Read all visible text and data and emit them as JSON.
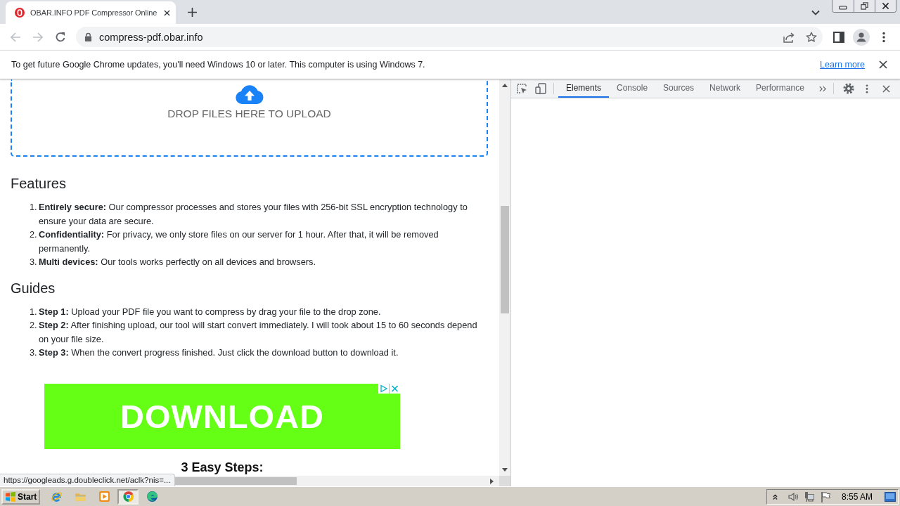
{
  "browser": {
    "tabs": [
      {
        "title": "OBAR.INFO PDF Compressor Online",
        "selected": true
      }
    ],
    "nav_buttons": [
      {
        "kind": "back",
        "disabled": true
      },
      {
        "kind": "forward",
        "disabled": true
      },
      {
        "kind": "reload",
        "disabled": false
      }
    ],
    "address": {
      "url": "compress-pdf.obar.info"
    }
  },
  "infobar": {
    "message": "To get future Google Chrome updates, you'll need Windows 10 or later. This computer is using Windows 7.",
    "link": "Learn more"
  },
  "page": {
    "dropzone": {
      "label": "DROP FILES HERE TO UPLOAD"
    },
    "sections": [
      {
        "heading": "Features",
        "items": [
          {
            "number": "1.",
            "text": "**Entirely secure:** Our compressor processes and stores your files with 256-bit SSL encryption technology to ensure your data are secure."
          },
          {
            "number": "2.",
            "text": "**Confidentiality:** For privacy, we only store files on our server for 1 hour. After that, it will be removed permanently."
          },
          {
            "number": "3.",
            "text": "**Multi devices:** Our tools works perfectly on all devices and browsers."
          }
        ]
      },
      {
        "heading": "Guides",
        "items": [
          {
            "number": "1.",
            "text": "**Step 1:** Upload your PDF file you want to compress by drag your file to the drop zone."
          },
          {
            "number": "2.",
            "text": "**Step 2:** After finishing upload, our tool will start convert immediately. I will took about 15 to 60 seconds depend on your file size."
          },
          {
            "number": "3.",
            "text": "**Step 3:** When the convert progress finished. Just click the download button to download it."
          }
        ]
      }
    ],
    "ad": {
      "label": "DOWNLOAD"
    },
    "next_heading": "3 Easy Steps:",
    "status_url": "https://googleads.g.doubleclick.net/aclk?nis=..."
  },
  "devtools": {
    "tabs": [
      {
        "label": "Elements",
        "selected": true
      },
      {
        "label": "Console",
        "selected": false
      },
      {
        "label": "Sources",
        "selected": false
      },
      {
        "label": "Network",
        "selected": false
      },
      {
        "label": "Performance",
        "selected": false
      }
    ]
  },
  "taskbar": {
    "start_label": "Start",
    "apps": [
      {
        "kind": "ie",
        "selected": false
      },
      {
        "kind": "explorer",
        "selected": false
      },
      {
        "kind": "media",
        "selected": false
      },
      {
        "kind": "chrome",
        "selected": true
      },
      {
        "kind": "edge",
        "selected": false
      }
    ],
    "clock": "8:55 AM"
  }
}
